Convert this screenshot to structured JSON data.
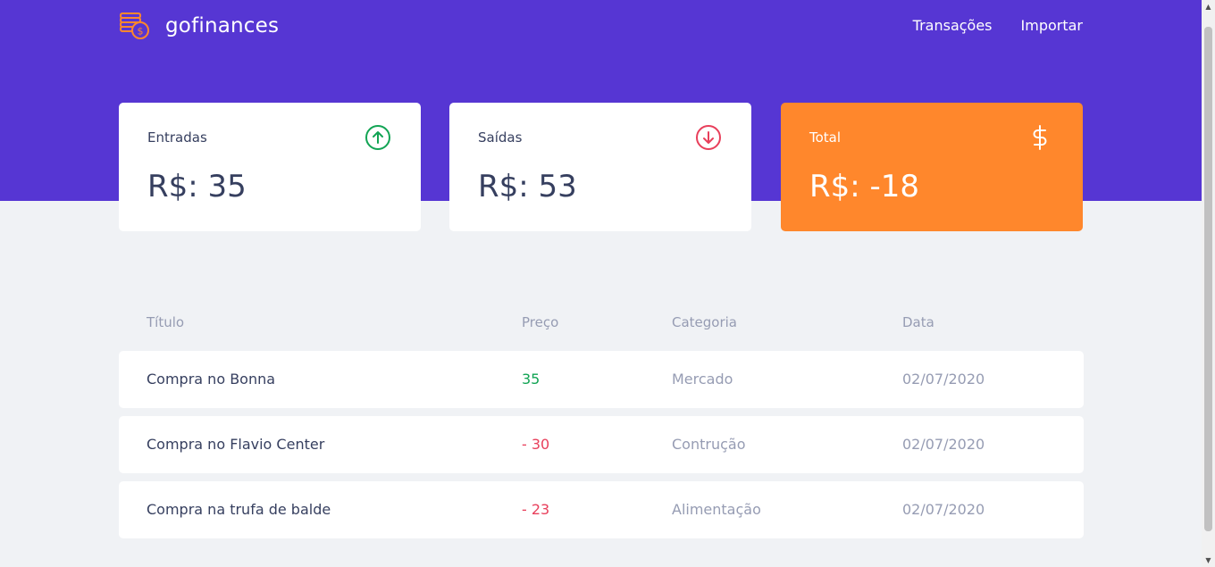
{
  "app": {
    "name": "gofinances"
  },
  "nav": {
    "items": [
      "Transações",
      "Importar"
    ]
  },
  "summary": {
    "income": {
      "label": "Entradas",
      "value": "R$: 35",
      "icon": "arrow-up-circle-icon"
    },
    "outcome": {
      "label": "Saídas",
      "value": "R$: 53",
      "icon": "arrow-down-circle-icon"
    },
    "total": {
      "label": "Total",
      "value": "R$: -18",
      "icon": "dollar-sign-icon"
    }
  },
  "table": {
    "headers": [
      "Título",
      "Preço",
      "Categoria",
      "Data"
    ],
    "rows": [
      {
        "title": "Compra no Bonna",
        "price": "35",
        "type": "income",
        "category": "Mercado",
        "date": "02/07/2020"
      },
      {
        "title": "Compra no Flavio Center",
        "price": "- 30",
        "type": "outcome",
        "category": "Contrução",
        "date": "02/07/2020"
      },
      {
        "title": "Compra na trufa de balde",
        "price": "- 23",
        "type": "outcome",
        "category": "Alimentação",
        "date": "02/07/2020"
      }
    ]
  },
  "colors": {
    "header": "#5636d3",
    "income": "#12a454",
    "outcome": "#e83f5b",
    "total": "#ff872c",
    "background": "#f0f2f5"
  }
}
